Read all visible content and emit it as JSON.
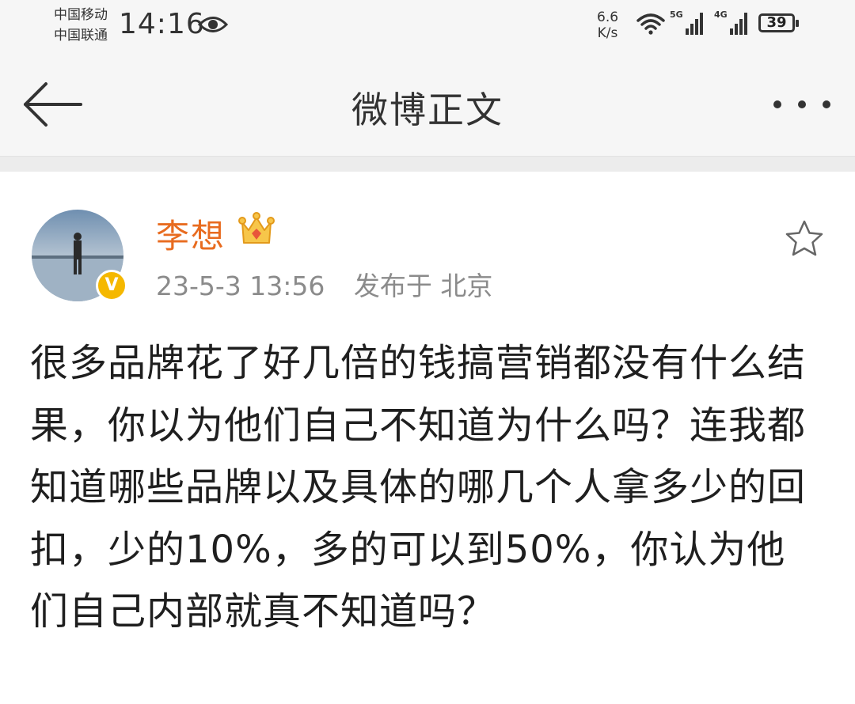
{
  "status_bar": {
    "carrier_1": "中国移动",
    "carrier_2": "中国联通",
    "time": "14:16",
    "net_speed_value": "6.6",
    "net_speed_unit": "K/s",
    "signal_1_label": "5G",
    "signal_2_label": "4G",
    "battery_level": "39",
    "icons": [
      "eye-icon",
      "wifi-icon",
      "signal-icon",
      "battery-icon"
    ]
  },
  "nav": {
    "title": "微博正文",
    "back_icon": "back-arrow-icon",
    "more_icon": "more-icon"
  },
  "post": {
    "author": "李想",
    "author_color": "#e86b1f",
    "verified_badge": "V",
    "time": "23-5-3 13:56",
    "location": "发布于 北京",
    "content": "很多品牌花了好几倍的钱搞营销都没有什么结果，你以为他们自己不知道为什么吗？连我都知道哪些品牌以及具体的哪几个人拿多少的回扣，少的10%，多的可以到50%，你认为他们自己内部就真不知道吗？"
  }
}
